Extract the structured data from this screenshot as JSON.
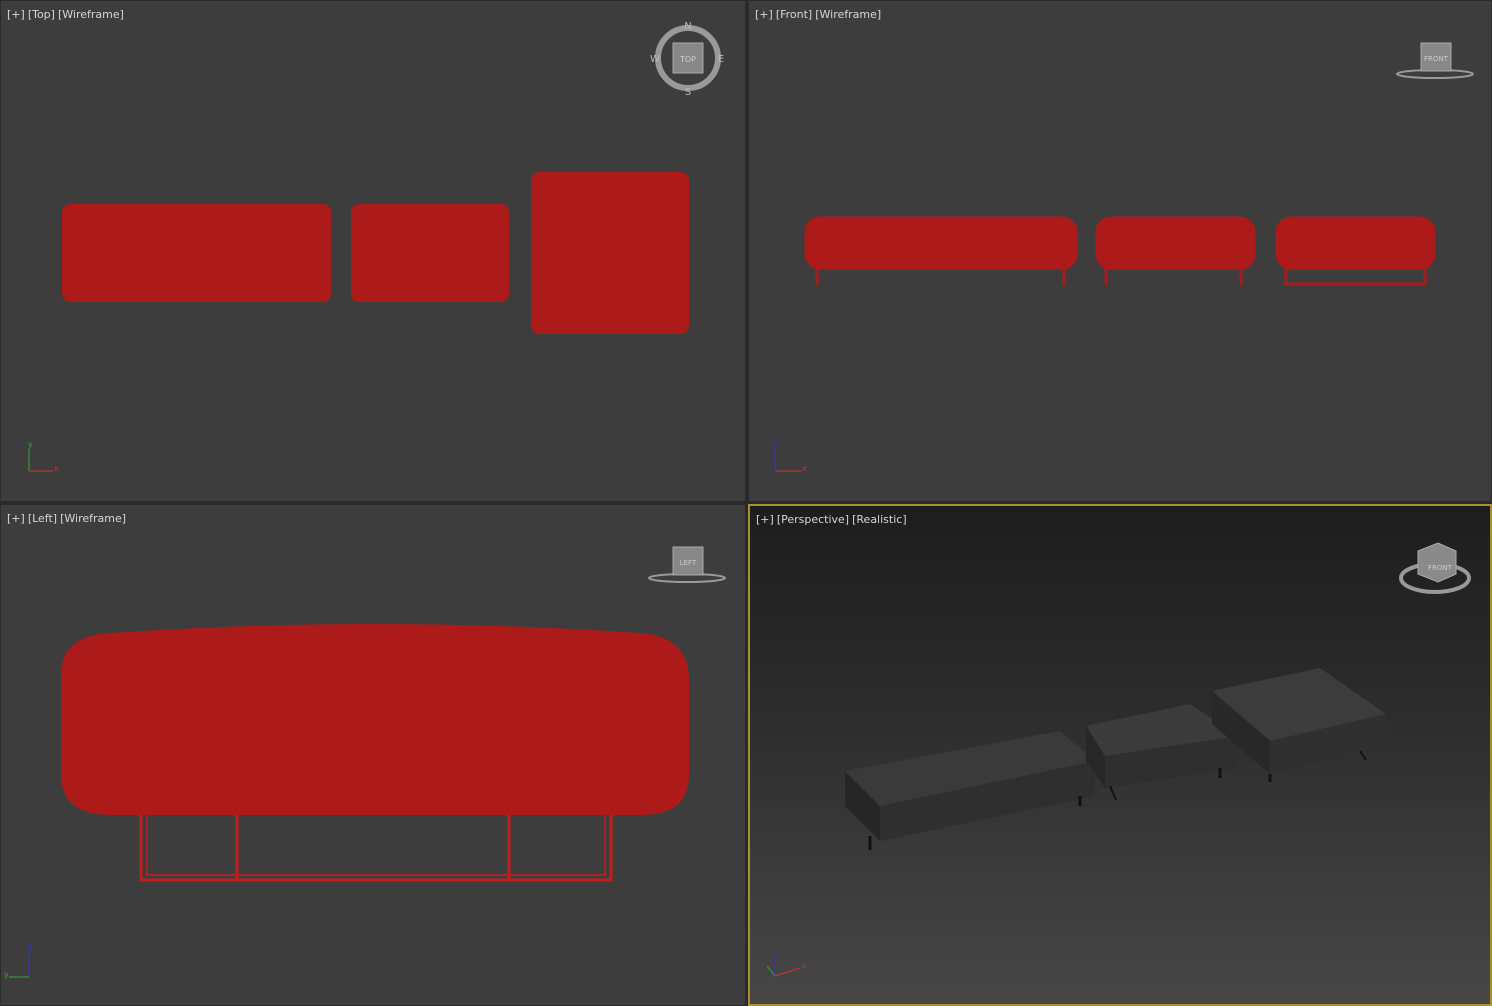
{
  "viewports": [
    {
      "plus": "[+]",
      "view": "[Top]",
      "shading": "[Wireframe]",
      "cube": "TOP"
    },
    {
      "plus": "[+]",
      "view": "[Front]",
      "shading": "[Wireframe]",
      "cube": "FRONT"
    },
    {
      "plus": "[+]",
      "view": "[Left]",
      "shading": "[Wireframe]",
      "cube": "LEFT"
    },
    {
      "plus": "[+]",
      "view": "[Perspective]",
      "shading": "[Realistic]",
      "cube": "FRONT"
    }
  ],
  "compass": {
    "n": "N",
    "e": "E",
    "s": "S",
    "w": "W"
  },
  "axes": {
    "x": "x",
    "y": "y",
    "z": "z"
  },
  "colors": {
    "object": "#ac1a1a",
    "active_border": "#a8902a",
    "viewport_bg": "#3d3d3d"
  }
}
